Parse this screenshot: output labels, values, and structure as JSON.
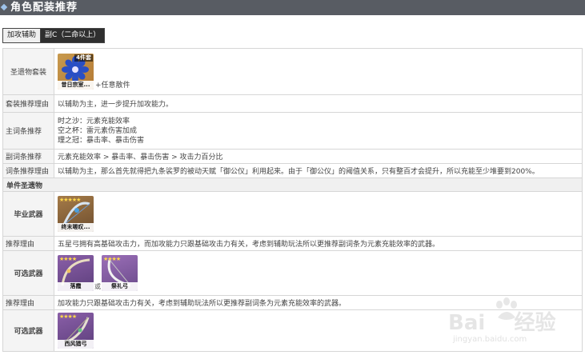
{
  "header": {
    "title": "角色配装推荐"
  },
  "tabs": [
    {
      "label": "加攻辅助"
    },
    {
      "label": "副C（二命以上）"
    }
  ],
  "artifact_set": {
    "label": "圣遗物套装",
    "card_name": "昔日宗室...",
    "card_badge": "4件套",
    "plus_text": "+任意散件"
  },
  "set_reason": {
    "label": "套装推荐理由",
    "text": "以辅助为主，进一步提升加攻能力。"
  },
  "main_stats": {
    "label": "主词条推荐",
    "lines": [
      {
        "k": "时之沙",
        "v": "：元素充能效率"
      },
      {
        "k": "空之杯",
        "v": "：雷元素伤害加成"
      },
      {
        "k": "理之冠",
        "v": "：暴击率、暴击伤害"
      }
    ]
  },
  "sub_stats": {
    "label": "副词条推荐",
    "text": "元素充能效率 > 暴击率、暴击伤害 > 攻击力百分比"
  },
  "sub_reason": {
    "label": "词条推荐理由",
    "text": "以辅助为主，那么首先就得把九条裟罗的被动天赋「御公仪」利用起来。由于「御公仪」的阈值关系，只有整百才会提升，所以充能至少堆要到200%。"
  },
  "weapons_section": {
    "label": "单件圣遗物"
  },
  "best_weapon": {
    "label": "毕业武器",
    "card_name": "终末嗟叹...",
    "stars": "★★★★★"
  },
  "best_reason": {
    "label": "推荐理由",
    "text": "五星弓拥有高基础攻击力，而加攻能力只跟基础攻击力有关，考虑到辅助玩法所以更推荐副词条为元素充能效率的武器。"
  },
  "alt_weapons": {
    "label": "可选武器",
    "cards": [
      {
        "name": "落霞",
        "stars": "★★★★"
      },
      {
        "name": "祭礼弓",
        "stars": "★★★★"
      }
    ],
    "or_text": "或"
  },
  "alt_reason": {
    "label": "推荐理由",
    "text": "加攻能力只跟基础攻击力有关，考虑到辅助玩法所以更推荐副词条为元素充能效率的武器。"
  },
  "alt_weapons2": {
    "label": "可选武器",
    "card_name": "西风猎弓",
    "stars": "★★★★"
  },
  "watermark": {
    "brand": "Bai",
    "brand2": "经验",
    "domain": "jingyan.baidu.com"
  }
}
